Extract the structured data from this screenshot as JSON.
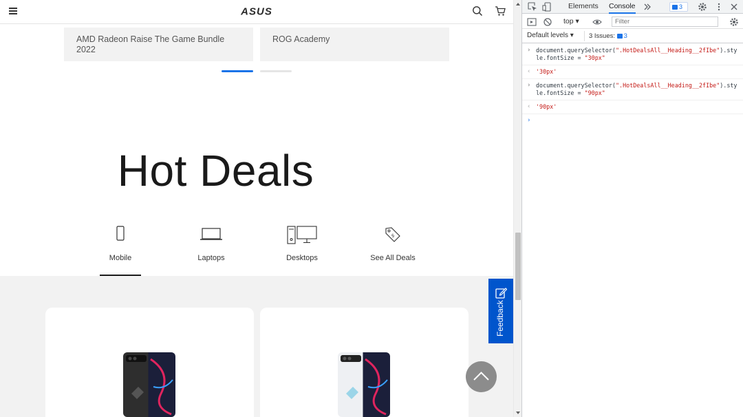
{
  "header": {
    "logo_text": "ASUS",
    "icons": [
      "menu-icon",
      "search-icon",
      "cart-icon"
    ]
  },
  "promos": [
    {
      "label": "AMD Radeon Raise The Game Bundle 2022"
    },
    {
      "label": "ROG Academy"
    }
  ],
  "carousel": {
    "active_index": 0,
    "count": 2,
    "accent": "#1a73e8"
  },
  "hot_deals": {
    "title": "Hot Deals",
    "tabs": [
      {
        "label": "Mobile",
        "icon": "phone-icon",
        "selected": true
      },
      {
        "label": "Laptops",
        "icon": "laptop-icon",
        "selected": false
      },
      {
        "label": "Desktops",
        "icon": "desktop-icon",
        "selected": false
      },
      {
        "label": "See All Deals",
        "icon": "tag-icon",
        "selected": false
      }
    ]
  },
  "feedback": {
    "label": "Feedback",
    "color": "#0055cc"
  },
  "devtools": {
    "tabs": [
      {
        "label": "Elements",
        "active": false
      },
      {
        "label": "Console",
        "active": true
      }
    ],
    "issue_count": "3",
    "context": "top",
    "filter_placeholder": "Filter",
    "log_levels": "Default levels",
    "issues_label": "3 Issues:",
    "issues_count": "3",
    "console": [
      {
        "type": "input",
        "prefix": "document.querySelector(",
        "selector": "\".HotDealsAll__Heading__2fIbe\"",
        "suffix": ").style.fontSize = ",
        "value": "\"30px\""
      },
      {
        "type": "result",
        "text": "'30px'"
      },
      {
        "type": "input",
        "prefix": "document.querySelector(",
        "selector": "\".HotDealsAll__Heading__2fIbe\"",
        "suffix": ").style.fontSize = ",
        "value": "\"90px\""
      },
      {
        "type": "result",
        "text": "'90px'"
      }
    ]
  }
}
